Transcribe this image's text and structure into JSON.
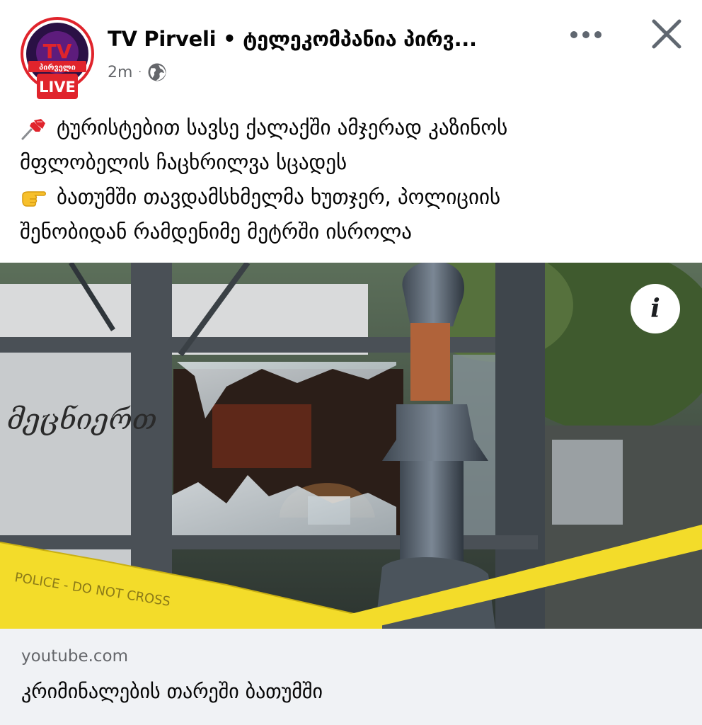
{
  "post": {
    "author": "TV Pirveli • ტელეკომპანია პირვ...",
    "time": "2m",
    "avatar_brand": "პირველი",
    "avatar_badge": "LIVE",
    "avatar_tv": "TV",
    "caption_lines": [
      "ტურისტებით სავსე ქალაქში ამჯერად კაზინოს",
      "მფლობელის ჩაცხრილვა სცადეს",
      "ბათუმში თავდამსხმელმა ხუთჯერ, პოლიციის",
      "შენობიდან რამდენიმე მეტრში ისროლა"
    ],
    "caption_icons": [
      "pushpin-icon",
      "pointing-hand-icon"
    ],
    "media_sign_text": "მეცნიერთ",
    "tape_text": "POLICE - DO NOT CROSS"
  },
  "link_preview": {
    "domain": "youtube.com",
    "title": "კრიმინალების თარეში ბათუმში"
  },
  "colors": {
    "name": "#050505",
    "secondary": "#65676b",
    "card_bg": "#f0f2f5",
    "live_red": "#e0242c",
    "tape_yellow": "#f3dc2a"
  }
}
